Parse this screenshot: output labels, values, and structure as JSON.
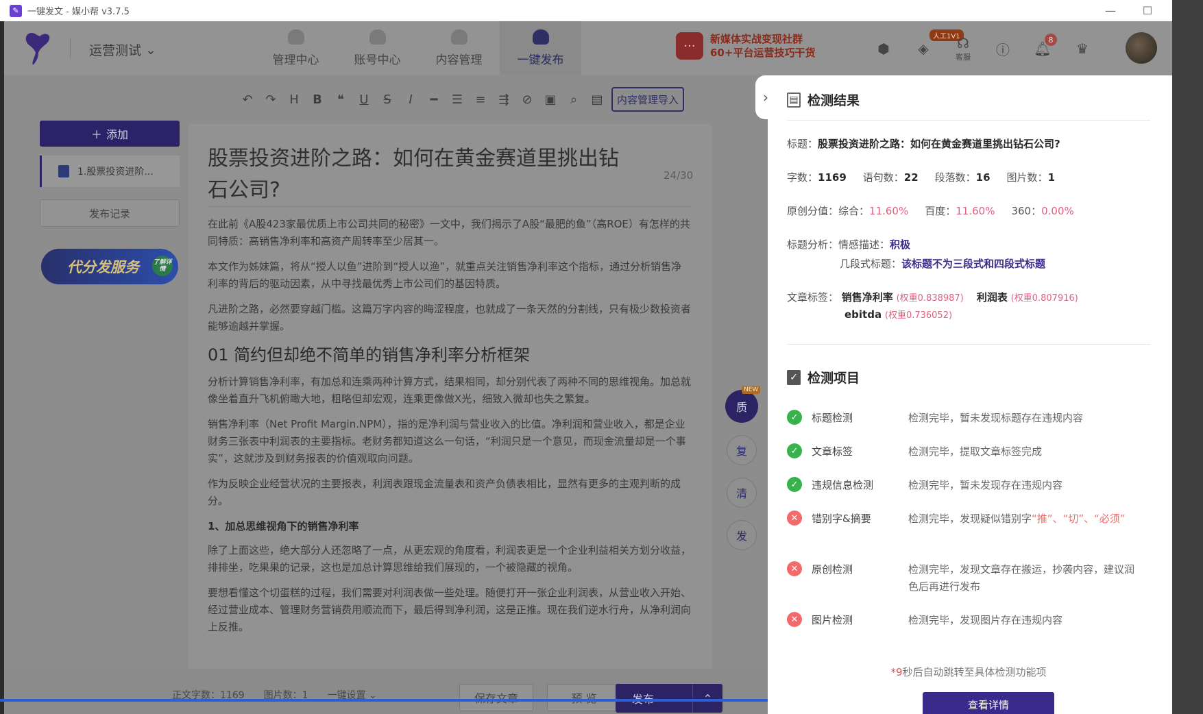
{
  "window": {
    "title": "一键发文 - 媒小帮 v3.7.5",
    "min": "—",
    "max": "☐",
    "close": "✕"
  },
  "nav": {
    "workspace": "运营测试",
    "tabs": [
      {
        "label": "管理中心"
      },
      {
        "label": "账号中心"
      },
      {
        "label": "内容管理"
      },
      {
        "label": "一键发布"
      }
    ],
    "promo_line1": "新媒体实战变现社群",
    "promo_line2": "60+平台运营技巧干货",
    "ai_badge": "人工1V1",
    "service_label": "客服",
    "notif_count": "8"
  },
  "toolbar": {
    "import_label": "内容管理导入"
  },
  "left": {
    "add_label": "添加",
    "doc_item": "1.股票投资进阶...",
    "history_label": "发布记录",
    "service_banner": "代分发服务",
    "service_tag": "了解详情"
  },
  "editor": {
    "title": "股票投资进阶之路：如何在黄金赛道里挑出钻石公司?",
    "title_count": "24/30",
    "p1": "在此前《A股423家最优质上市公司共同的秘密》一文中，我们揭示了A股“最肥的鱼”（高ROE）有怎样的共同特质：高销售净利率和高资产周转率至少居其一。",
    "p2": "本文作为姊妹篇，将从“授人以鱼”进阶到“授人以渔”，就重点关注销售净利率这个指标，通过分析销售净利率的背后的驱动因素，从中寻找最优秀上市公司们的基因特质。",
    "p3": "凡进阶之路，必然要穿越门槛。这篇万字内容的晦涩程度，也就成了一条天然的分割线，只有极少数投资者能够逾越并掌握。",
    "h2": "01 简约但却绝不简单的销售净利率分析框架",
    "p4": "分析计算销售净利率，有加总和连乘两种计算方式，结果相同，却分别代表了两种不同的思维视角。加总就像坐着直升飞机俯瞰大地，粗略但却宏观，连乘更像做X光，细致入微却也失之繁复。",
    "p5": "销售净利率（Net Profit Margin.NPM），指的是净利润与营业收入的比值。净利润和营业收入，都是企业财务三张表中利润表的主要指标。老财务都知道这么一句话，“利润只是一个意见，而现金流量却是一个事实”，这就涉及到财务报表的价值观取向问题。",
    "p6": "作为反映企业经营状况的主要报表，利润表跟现金流量表和资产负债表相比，显然有更多的主观判断的成分。",
    "h3": "1、加总思维视角下的销售净利率",
    "p7": "除了上面这些，绝大部分人还忽略了一点，从更宏观的角度看，利润表更是一个企业利益相关方划分收益，排排坐，吃果果的记录，这也是加总计算思维给我们展现的，一个被隐藏的视角。",
    "p8": "要想看懂这个切蛋糕的过程，我们需要对利润表做一些处理。随便打开一张企业利润表，从营业收入开始、经过营业成本、管理财务营销费用顺流而下，最后得到净利润，这是正推。现在我们逆水行舟，从净利润向上反推。"
  },
  "side_buttons": {
    "b1": "质",
    "b1_new": "NEW",
    "b2": "复",
    "b3": "清",
    "b4": "发"
  },
  "bottom": {
    "word_count": "正文字数：1169",
    "image_count": "图片数：1",
    "settings": "一键设置",
    "save": "保存文章",
    "preview": "预 览",
    "publish": "发布"
  },
  "panel": {
    "result_title": "检测结果",
    "title_label": "标题：",
    "title_value": "股票投资进阶之路：如何在黄金赛道里挑出钻石公司?",
    "stats": {
      "words_label": "字数：",
      "words": "1169",
      "sentences_label": "语句数：",
      "sentences": "22",
      "paragraphs_label": "段落数：",
      "paragraphs": "16",
      "images_label": "图片数：",
      "images": "1"
    },
    "originality": {
      "label": "原创分值：",
      "overall_label": "综合：",
      "overall": "11.60%",
      "baidu_label": "百度：",
      "baidu": "11.60%",
      "s360_label": "360：",
      "s360": "0.00%"
    },
    "title_analysis": {
      "label": "标题分析：",
      "emotion_label": "情感描述：",
      "emotion": "积极",
      "segment_label": "几段式标题：",
      "segment": "该标题不为三段式和四段式标题"
    },
    "tags": {
      "label": "文章标签：",
      "t1": "销售净利率",
      "w1": "(权重0.838987)",
      "t2": "利润表",
      "w2": "(权重0.807916)",
      "t3": "ebitda",
      "w3": "(权重0.736052)"
    },
    "items_title": "检测项目",
    "items": [
      {
        "name": "标题检测",
        "desc": "检测完毕，暂未发现标题存在违规内容"
      },
      {
        "name": "文章标签",
        "desc": "检测完毕，提取文章标签完成"
      },
      {
        "name": "违规信息检测",
        "desc": "检测完毕，暂未发现存在违规内容"
      },
      {
        "name": "错别字&摘要",
        "desc_prefix": "检测完毕，发现疑似错别字",
        "desc_red": "“推”、“切”、“必须”"
      },
      {
        "name": "原创检测",
        "desc": "检测完毕，发现文章存在搬运，抄袭内容，建议润色后再进行发布"
      },
      {
        "name": "图片检测",
        "desc": "检测完毕，发现图片存在违规内容"
      }
    ],
    "auto_jump_prefix": "*",
    "auto_jump_seconds": "9",
    "auto_jump_text": "秒后自动跳转至具体检测功能项",
    "view_detail": "查看详情"
  }
}
